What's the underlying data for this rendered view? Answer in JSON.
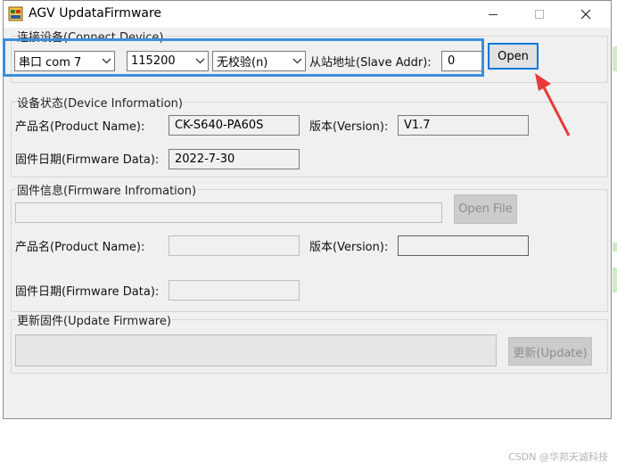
{
  "window": {
    "title": "AGV UpdataFirmware",
    "controls": {
      "minimize": "minimize",
      "maximize": "maximize",
      "close": "close"
    }
  },
  "connect": {
    "legend": "连接设备(Connect Device)",
    "port": "串口 com 7",
    "baud": "115200",
    "parity": "无校验(n)",
    "slave_label": "从站地址(Slave Addr):",
    "slave_value": "0",
    "open_button": "Open"
  },
  "device_info": {
    "legend": "设备状态(Device Information)",
    "product_label": "产品名(Product Name):",
    "product_value": "CK-S640-PA60S",
    "version_label": "版本(Version):",
    "version_value": "V1.7",
    "date_label": "固件日期(Firmware Data):",
    "date_value": "2022-7-30"
  },
  "firmware_info": {
    "legend": "固件信息(Firmware Infromation)",
    "file_path": "",
    "open_file_button": "Open File",
    "product_label": "产品名(Product Name):",
    "product_value": "",
    "version_label": "版本(Version):",
    "version_value": "",
    "date_label": "固件日期(Firmware Data):",
    "date_value": ""
  },
  "update": {
    "legend": "更新固件(Update Firmware)",
    "progress_percent": 0,
    "update_button": "更新(Update)"
  },
  "watermark": "CSDN @华邦天诚科技",
  "colors": {
    "highlight": "#3b8fdc",
    "arrow": "#e8393a",
    "focus": "#0078d7"
  },
  "icons": {
    "app": "app-icon",
    "dropdown": "chevron-down-icon",
    "annotation": "arrow-icon"
  }
}
